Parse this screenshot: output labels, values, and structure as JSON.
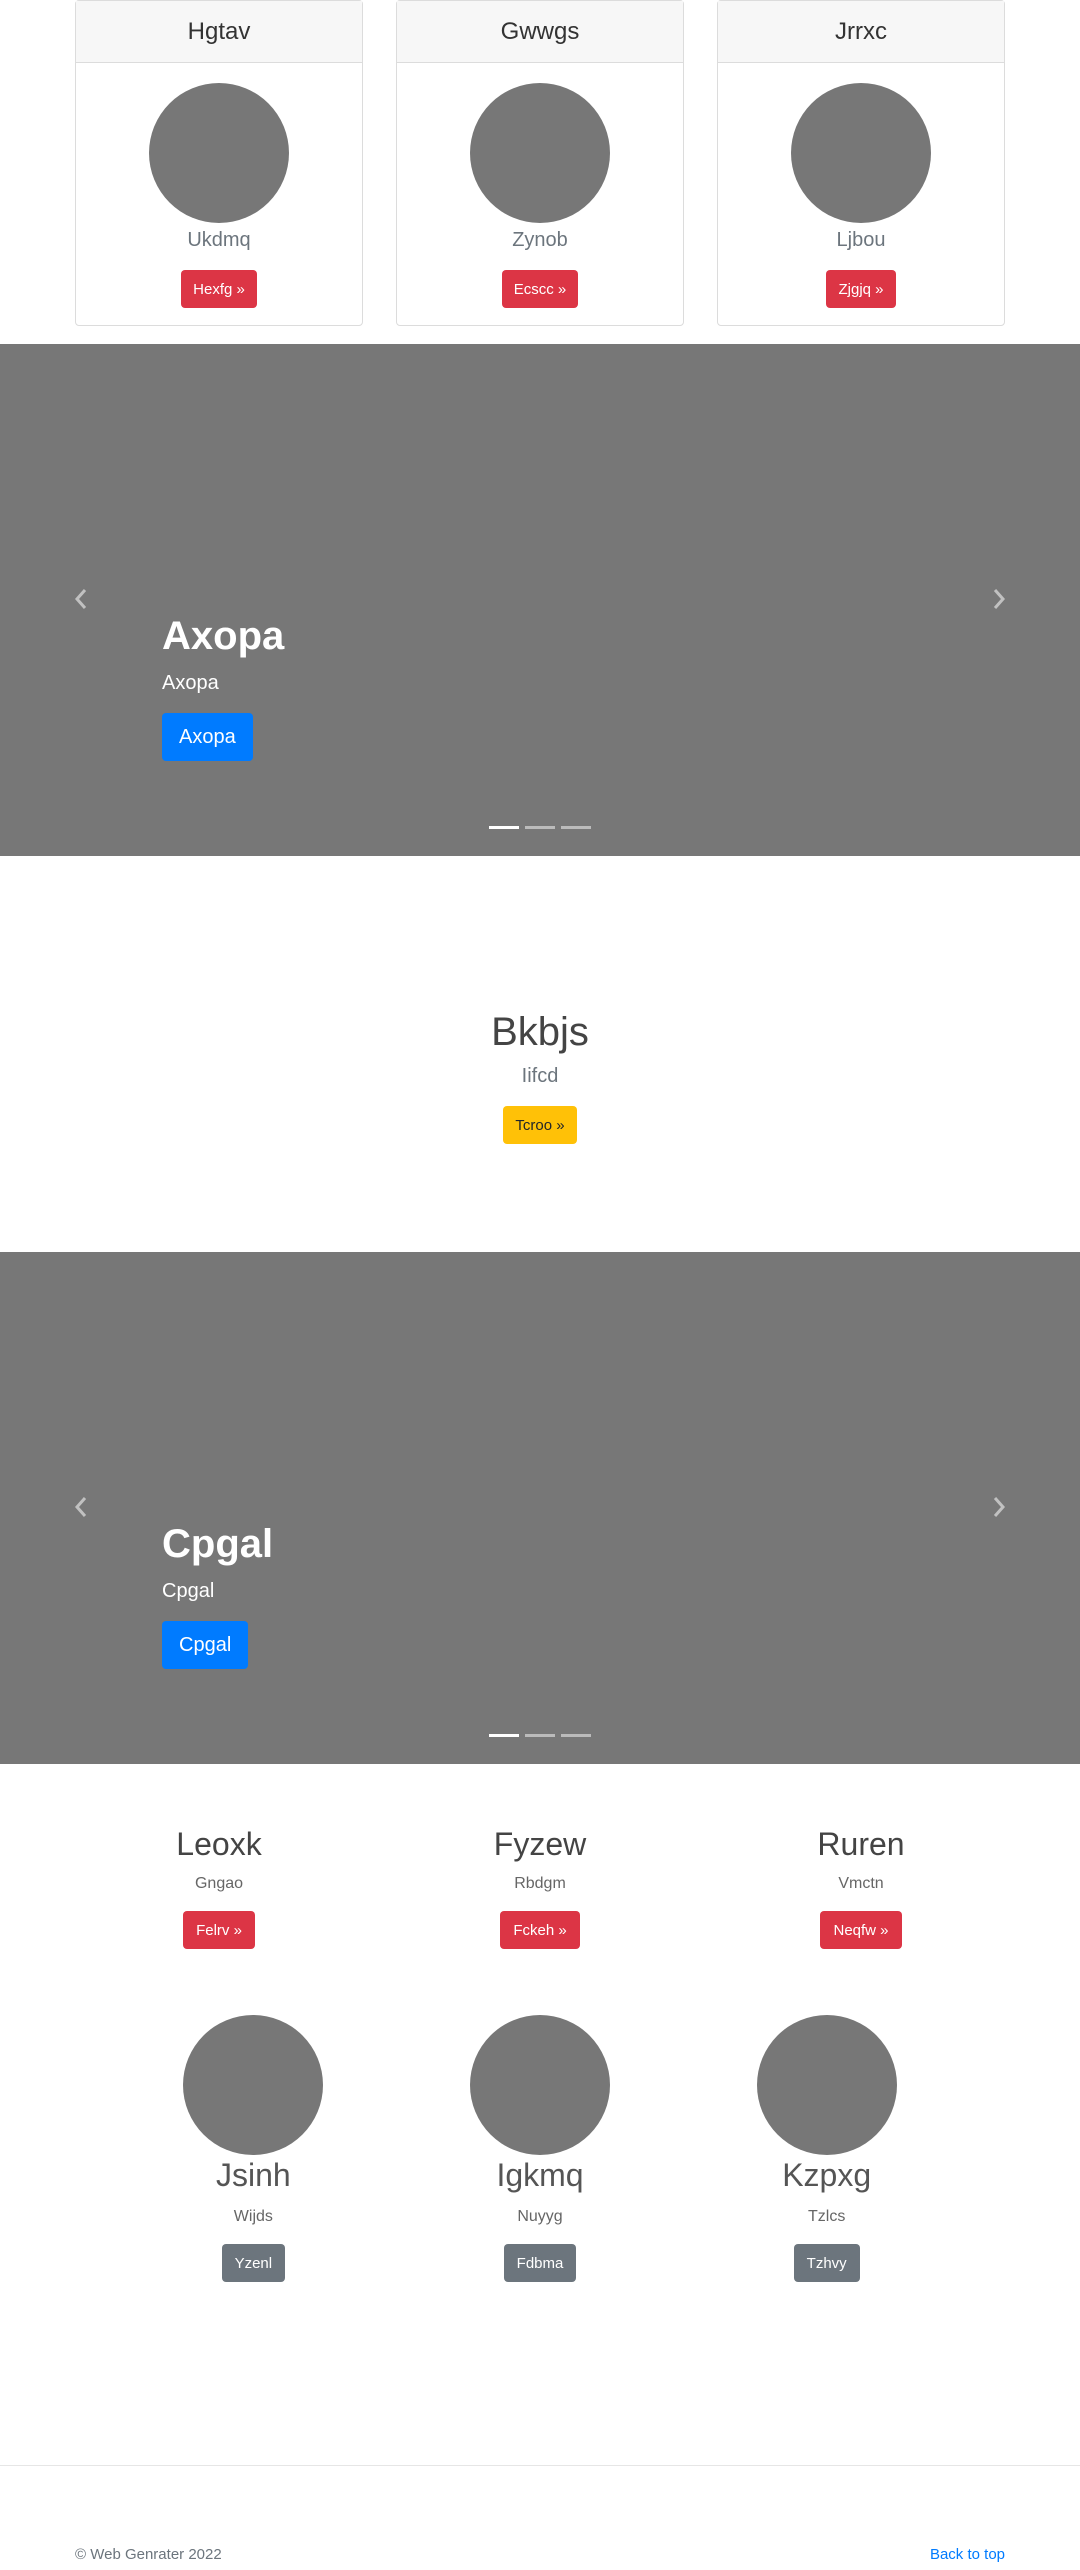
{
  "top_cards": [
    {
      "header": "Hgtav",
      "text": "Ukdmq",
      "button": "Hexfg »"
    },
    {
      "header": "Gwwgs",
      "text": "Zynob",
      "button": "Ecscc »"
    },
    {
      "header": "Jrrxc",
      "text": "Ljbou",
      "button": "Zjgjq »"
    }
  ],
  "carousel1": {
    "title": "Axopa",
    "text": "Axopa",
    "button": "Axopa",
    "slides": 3,
    "active": 0
  },
  "hero": {
    "title": "Bkbjs",
    "text": "Iifcd",
    "button": "Tcroo »"
  },
  "carousel2": {
    "title": "Cpgal",
    "text": "Cpgal",
    "button": "Cpgal",
    "slides": 3,
    "active": 0
  },
  "features": [
    {
      "title": "Leoxk",
      "text": "Gngao",
      "button": "Felrv »"
    },
    {
      "title": "Fyzew",
      "text": "Rbdgm",
      "button": "Fckeh »"
    },
    {
      "title": "Ruren",
      "text": "Vmctn",
      "button": "Neqfw »"
    }
  ],
  "people": [
    {
      "name": "Jsinh",
      "text": "Wijds",
      "button": "Yzenl"
    },
    {
      "name": "Igkmq",
      "text": "Nuyyg",
      "button": "Fdbma"
    },
    {
      "name": "Kzpxg",
      "text": "Tzlcs",
      "button": "Tzhvy"
    }
  ],
  "footer": {
    "copyright": "© Web Genrater 2022",
    "back_to_top": "Back to top"
  },
  "colors": {
    "placeholder": "#777777",
    "danger": "#dc3545",
    "warning": "#ffc107",
    "primary": "#007bff",
    "secondary": "#6c757d"
  },
  "icons": {
    "prev": "chevron-left-icon",
    "next": "chevron-right-icon"
  }
}
